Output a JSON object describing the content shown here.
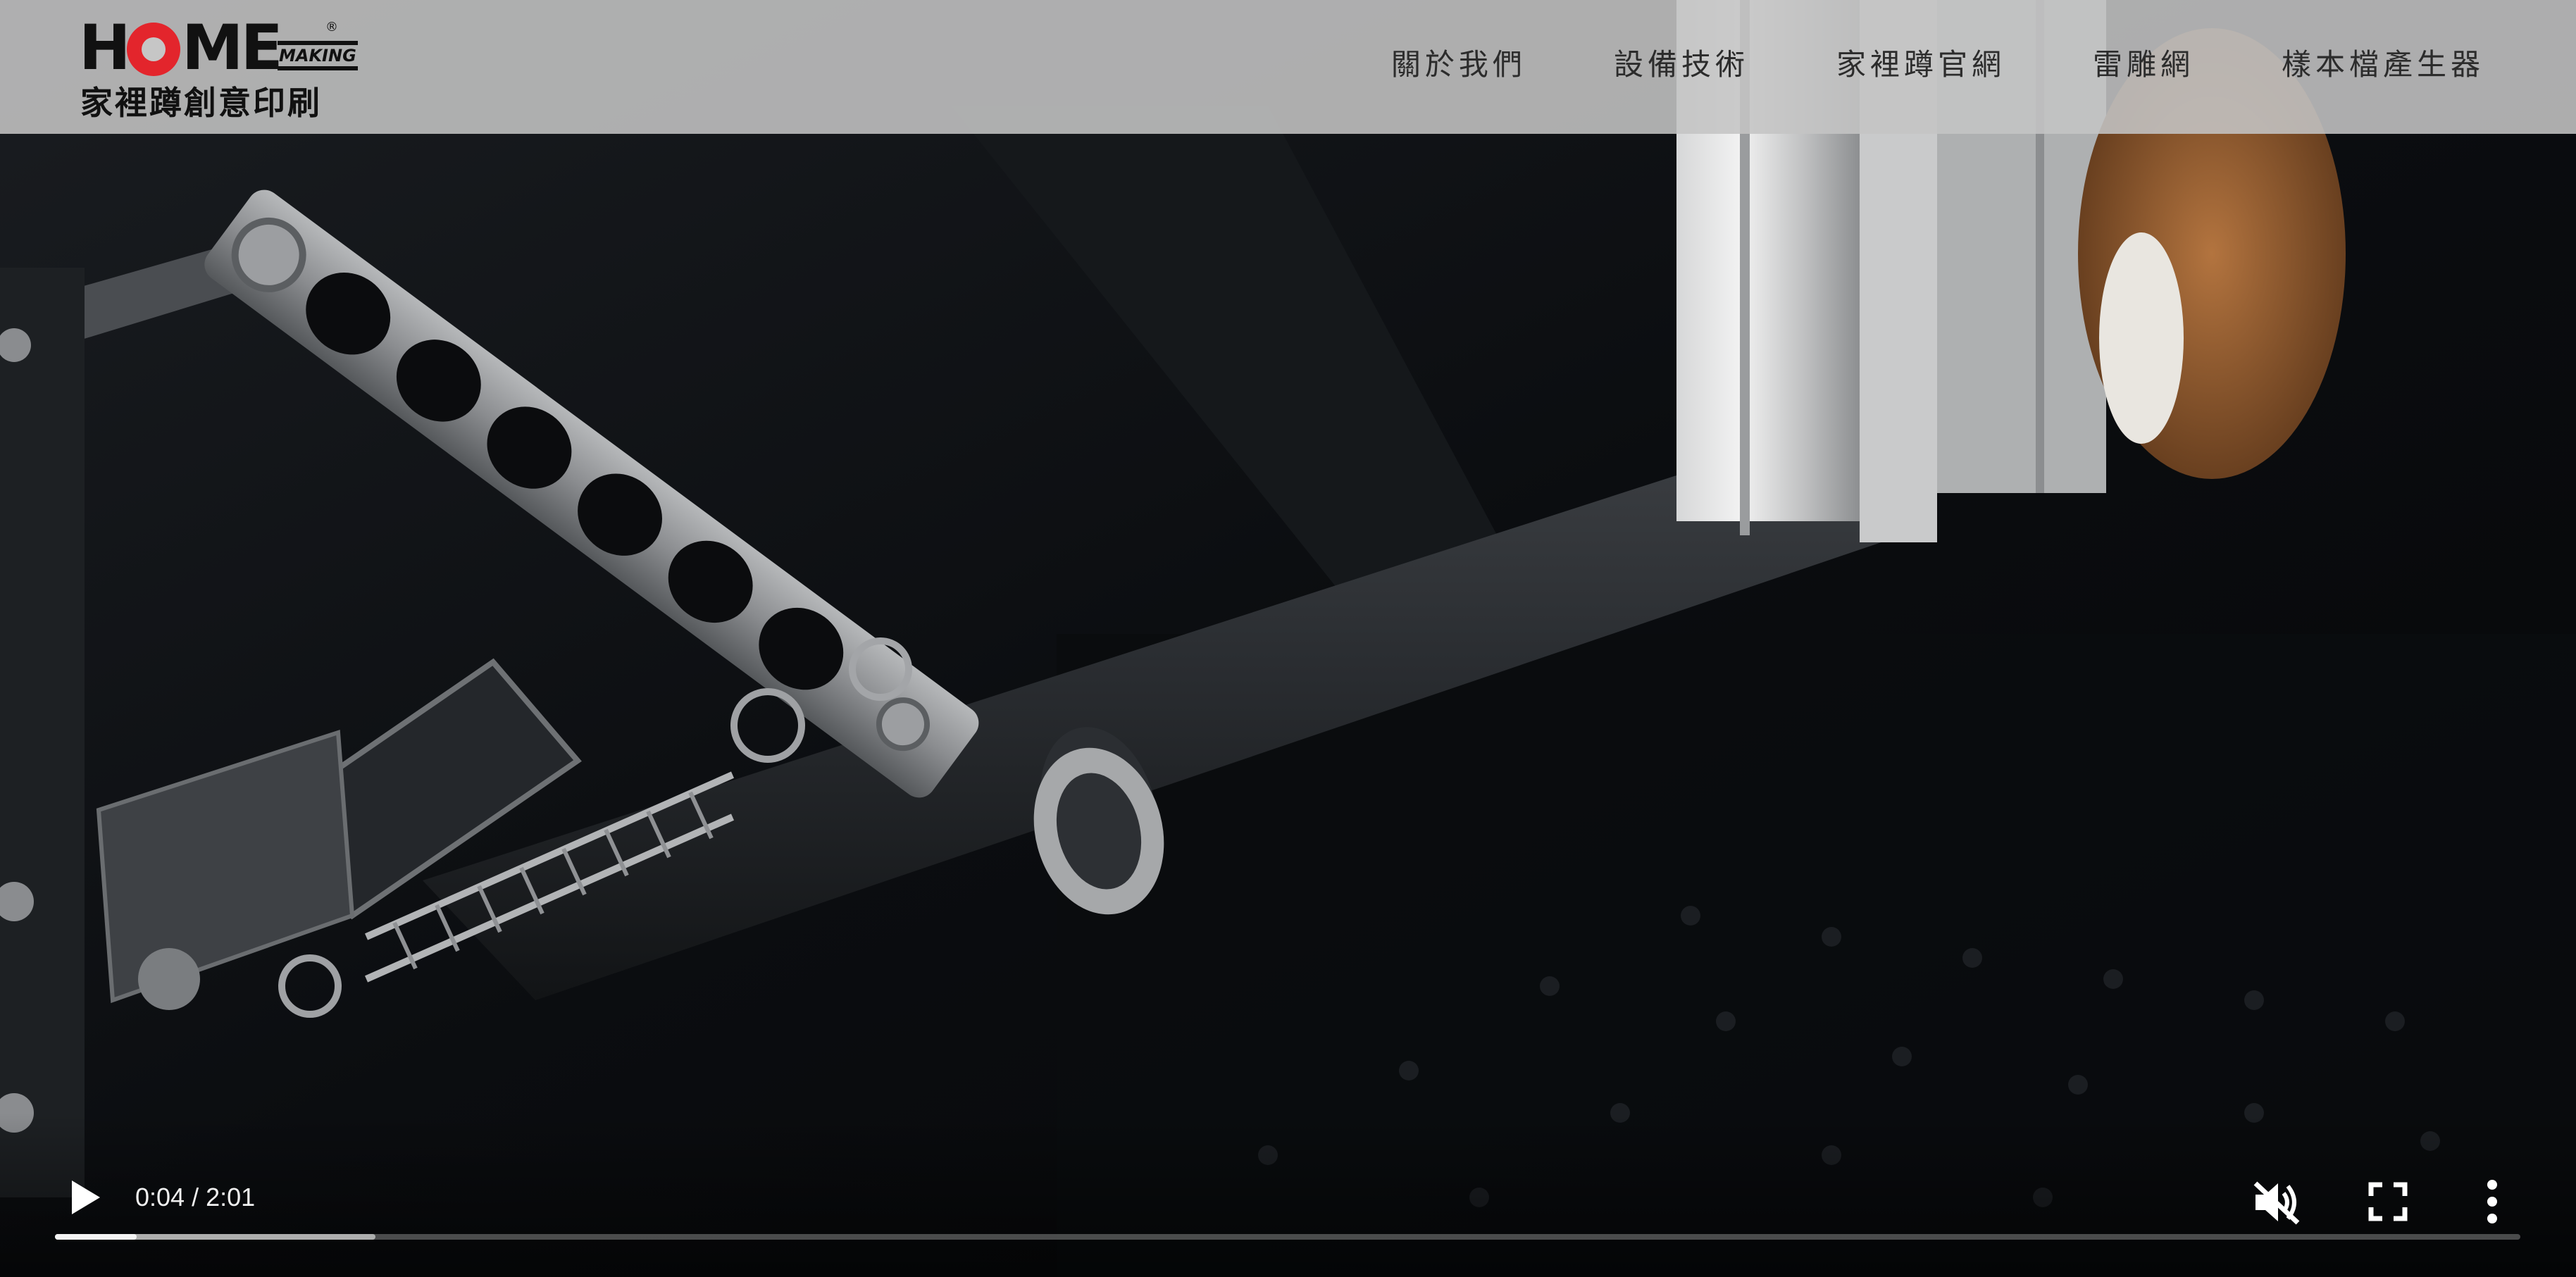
{
  "header": {
    "logo": {
      "wordmark": "HOME",
      "wordmark_small": "MAKING",
      "registered": "®",
      "chinese_name": "家裡蹲創意印刷"
    },
    "nav": [
      {
        "label": "關於我們"
      },
      {
        "label": "設備技術"
      },
      {
        "label": "家裡蹲官網"
      },
      {
        "label": "雷雕網"
      },
      {
        "label": "樣本檔產生器"
      }
    ]
  },
  "video": {
    "current_time": "0:04",
    "separator": " / ",
    "duration": "2:01",
    "progress_fraction": 0.033,
    "buffered_fraction": 0.13,
    "state": "paused",
    "muted": true,
    "icons": {
      "play": "play-icon",
      "mute": "volume-muted-icon",
      "fullscreen": "fullscreen-icon",
      "more": "more-vertical-icon"
    }
  },
  "colors": {
    "header_bg": "#c4c4c4",
    "brand_red": "#e3252c",
    "nav_text": "#2c2c2c",
    "progress_played": "#f4f4f4"
  }
}
